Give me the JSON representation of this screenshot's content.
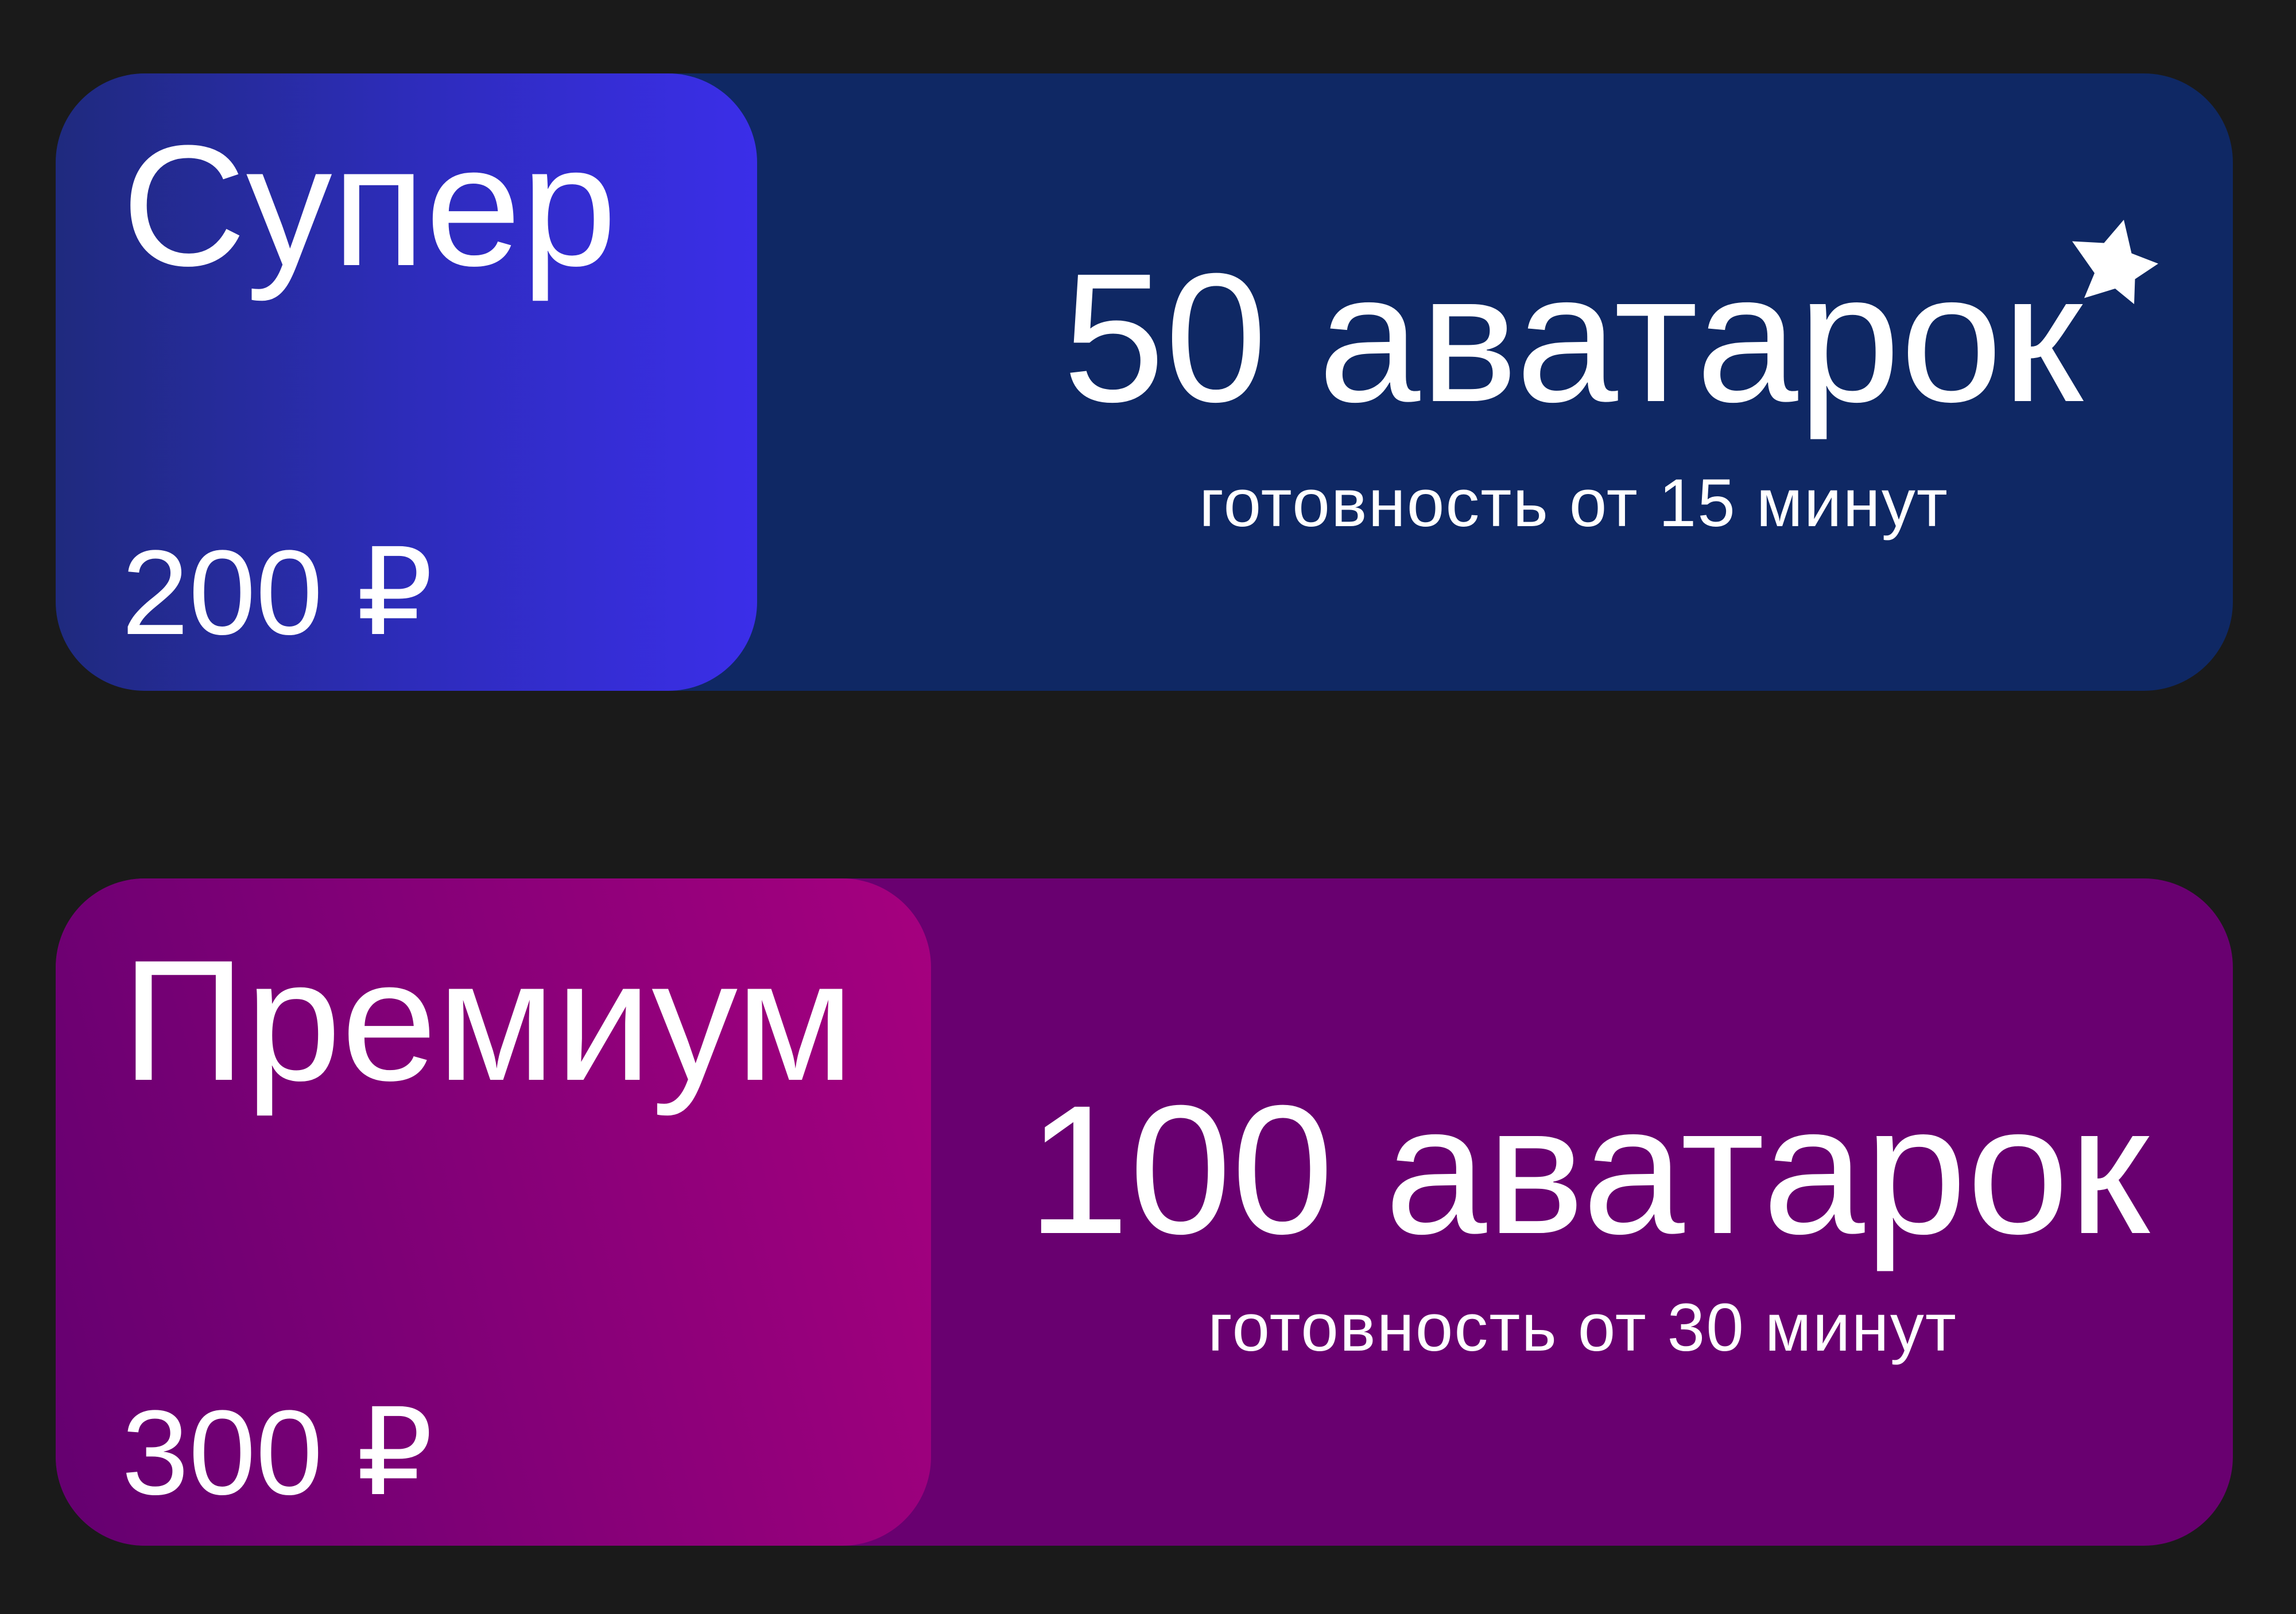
{
  "plans": [
    {
      "name": "Супер",
      "price": "200 ₽",
      "count": "50 аватарок",
      "readiness": "готовность от 15 минут",
      "badge_icon": "star-icon",
      "colors": {
        "card": "#0f2864",
        "panel_start": "#1f2a7e",
        "panel_end": "#3b2ee9"
      }
    },
    {
      "name": "Премиум",
      "price": "300 ₽",
      "count": "100 аватарок",
      "readiness": "готовность от 30 минут",
      "colors": {
        "card": "#690070",
        "panel_start": "#640070",
        "panel_end": "#a6007f"
      }
    }
  ]
}
